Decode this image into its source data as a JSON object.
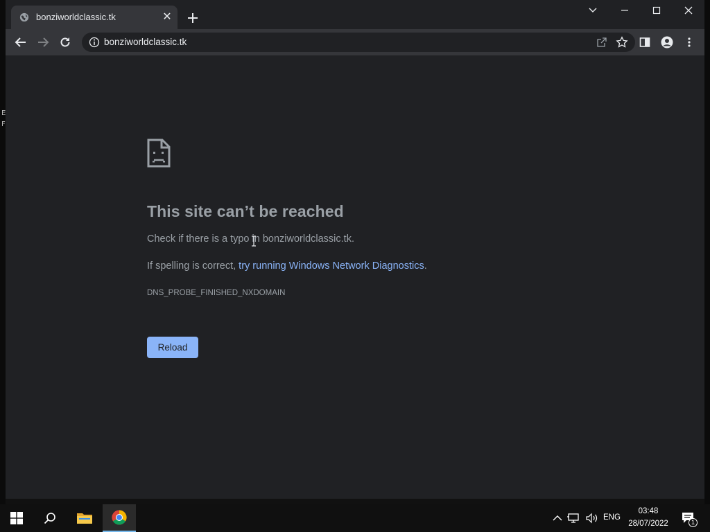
{
  "browser": {
    "tab": {
      "title": "bonziworldclassic.tk",
      "close_glyph": "✕"
    },
    "new_tab_icon": "plus-icon",
    "address_bar": {
      "url": "bonziworldclassic.tk"
    }
  },
  "error_page": {
    "title": "This site can’t be reached",
    "line1": "Check if there is a typo in bonziworldclassic.tk.",
    "line2_prefix": "If spelling is correct, ",
    "line2_link": "try running Windows Network Diagnostics",
    "line2_suffix": ".",
    "error_code": "DNS_PROBE_FINISHED_NXDOMAIN",
    "reload_label": "Reload"
  },
  "desktop": {
    "glyph_1": "E",
    "glyph_2": "F"
  },
  "taskbar": {
    "language": "ENG",
    "time": "03:48",
    "date": "28/07/2022",
    "notification_count": "1"
  },
  "colors": {
    "page_bg": "#202124",
    "toolbar_bg": "#35363a",
    "text_muted": "#9aa0a6",
    "link": "#8ab4f8",
    "button_bg": "#8ab4f8"
  }
}
